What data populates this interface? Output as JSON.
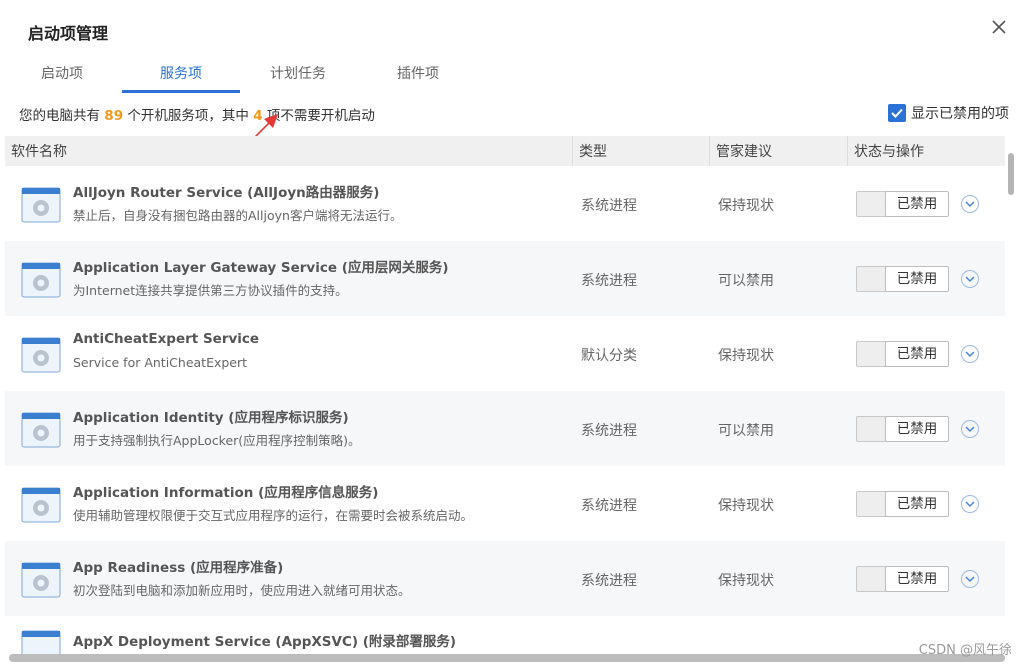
{
  "window": {
    "title": "启动项管理"
  },
  "tabs": [
    {
      "label": "启动项"
    },
    {
      "label": "服务项"
    },
    {
      "label": "计划任务"
    },
    {
      "label": "插件项"
    }
  ],
  "active_tab_index": 1,
  "summary": {
    "prefix": "您的电脑共有",
    "total": "89",
    "middle": "个开机服务项，其中",
    "count": "4",
    "suffix": "项不需要开机启动"
  },
  "show_disabled": {
    "label": "显示已禁用的项",
    "checked": true
  },
  "table": {
    "columns": [
      "软件名称",
      "类型",
      "管家建议",
      "状态与操作"
    ],
    "rows": [
      {
        "name": "AllJoyn Router Service (AllJoyn路由器服务)",
        "desc": "禁止后，自身没有捆包路由器的Alljoyn客户端将无法运行。",
        "type": "系统进程",
        "advice": "保持现状",
        "status": "已禁用"
      },
      {
        "name": "Application Layer Gateway Service (应用层网关服务)",
        "desc": "为Internet连接共享提供第三方协议插件的支持。",
        "type": "系统进程",
        "advice": "可以禁用",
        "status": "已禁用"
      },
      {
        "name": "AntiCheatExpert Service",
        "desc": "Service for AntiCheatExpert",
        "type": "默认分类",
        "advice": "保持现状",
        "status": "已禁用"
      },
      {
        "name": "Application Identity (应用程序标识服务)",
        "desc": "用于支持强制执行AppLocker(应用程序控制策略)。",
        "type": "系统进程",
        "advice": "可以禁用",
        "status": "已禁用"
      },
      {
        "name": "Application Information (应用程序信息服务)",
        "desc": "使用辅助管理权限便于交互式应用程序的运行，在需要时会被系统启动。",
        "type": "系统进程",
        "advice": "保持现状",
        "status": "已禁用"
      },
      {
        "name": "App Readiness (应用程序准备)",
        "desc": "初次登陆到电脑和添加新应用时，使应用进入就绪可用状态。",
        "type": "系统进程",
        "advice": "保持现状",
        "status": "已禁用"
      },
      {
        "name": "AppX Deployment Service (AppXSVC) (附录部署服务)",
        "desc": "",
        "type": "",
        "advice": "",
        "status": ""
      }
    ]
  },
  "watermark": "CSDN @风午徐",
  "colors": {
    "accent": "#2a72d6",
    "highlight": "#f39a1c",
    "annotation": "#e53935"
  }
}
